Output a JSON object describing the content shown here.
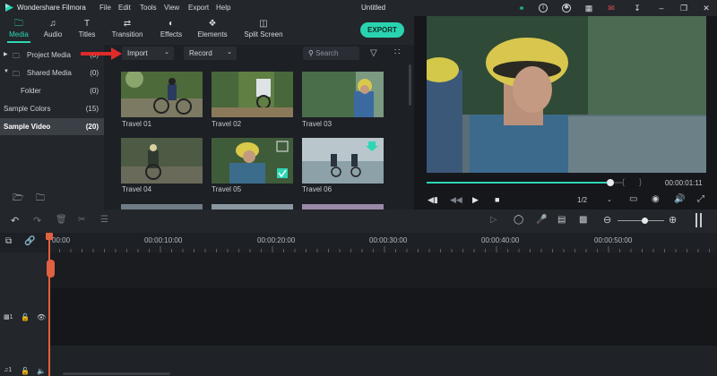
{
  "title_bar": {
    "app_name": "Wondershare Filmora",
    "menu": [
      "File",
      "Edit",
      "Tools",
      "View",
      "Export",
      "Help"
    ],
    "document_title": "Untitled"
  },
  "toolbar": {
    "tabs": [
      {
        "label": "Media",
        "icon": "folder-icon"
      },
      {
        "label": "Audio",
        "icon": "music-icon"
      },
      {
        "label": "Titles",
        "icon": "text-icon"
      },
      {
        "label": "Transition",
        "icon": "transition-icon"
      },
      {
        "label": "Effects",
        "icon": "effects-icon"
      },
      {
        "label": "Elements",
        "icon": "elements-icon"
      },
      {
        "label": "Split Screen",
        "icon": "split-screen-icon"
      }
    ],
    "active_tab": "Media",
    "export_label": "EXPORT"
  },
  "library": {
    "items": [
      {
        "label": "Project Media",
        "count": "(0)"
      },
      {
        "label": "Shared Media",
        "count": "(0)"
      },
      {
        "label": "Folder",
        "count": "(0)"
      },
      {
        "label": "Sample Colors",
        "count": "(15)"
      },
      {
        "label": "Sample Video",
        "count": "(20)",
        "selected": true
      }
    ]
  },
  "media": {
    "import_label": "Import",
    "record_label": "Record",
    "search_placeholder": "Search",
    "clips": [
      "Travel 01",
      "Travel 02",
      "Travel 03",
      "Travel 04",
      "Travel 05",
      "Travel 06"
    ]
  },
  "preview": {
    "progress": 0.95,
    "timecode": "00:00:01:11",
    "zoom": "1/2"
  },
  "timeline": {
    "ruler_labels": [
      "00:00",
      "00:00:10:00",
      "00:00:20:00",
      "00:00:30:00",
      "00:00:40:00",
      "00:00:50:00"
    ],
    "tracks": [
      {
        "number": "1",
        "kind": "video"
      },
      {
        "number": "1",
        "kind": "audio"
      }
    ]
  },
  "colors": {
    "accent": "#2ed6b4",
    "playhead": "#e0603f",
    "panel": "#23262b"
  }
}
